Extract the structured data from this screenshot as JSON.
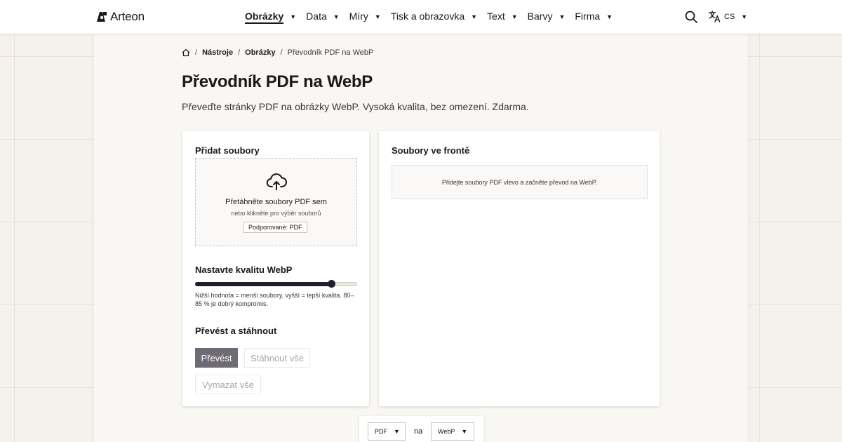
{
  "brand": {
    "name": "Arteon"
  },
  "nav": {
    "items": [
      {
        "label": "Obrázky",
        "active": true
      },
      {
        "label": "Data"
      },
      {
        "label": "Míry"
      },
      {
        "label": "Tisk a obrazovka"
      },
      {
        "label": "Text"
      },
      {
        "label": "Barvy"
      },
      {
        "label": "Firma"
      }
    ],
    "caret": "▼",
    "search_icon": "search-icon",
    "language": {
      "code": "CS",
      "icon": "translate-icon"
    }
  },
  "breadcrumb": {
    "home_icon": "home-icon",
    "separator": "/",
    "items": [
      "Nástroje",
      "Obrázky"
    ],
    "current": "Převodník PDF na WebP"
  },
  "page": {
    "title": "Převodník PDF na WebP",
    "subtitle": "Převeďte stránky PDF na obrázky WebP. Vysoká kvalita, bez omezení. Zdarma."
  },
  "upload": {
    "heading": "Přidat soubory",
    "drop_title": "Přetáhněte soubory PDF sem",
    "drop_sub": "nebo klikněte pro výběr souborů",
    "supported": "Podporované: PDF"
  },
  "quality": {
    "heading": "Nastavte kvalitu WebP",
    "value": 0.84,
    "hint": "Nižší hodnota = menší soubory, vyšší = lepší kvalita. 80–85 % je dobrý kompromis."
  },
  "actions": {
    "heading": "Převést a stáhnout",
    "convert": "Převést",
    "download_all": "Stáhnout vše",
    "clear_all": "Vymazat vše"
  },
  "queue": {
    "heading": "Soubory ve frontě",
    "empty": "Přidejte soubory PDF vlevo a začněte převod na WebP."
  },
  "format": {
    "from": "PDF",
    "mid": "na",
    "to": "WebP"
  },
  "colors": {
    "accent_dark": "#1e1e2e",
    "button_primary": "#6e6b74",
    "page_bg": "#f5f1ec"
  }
}
